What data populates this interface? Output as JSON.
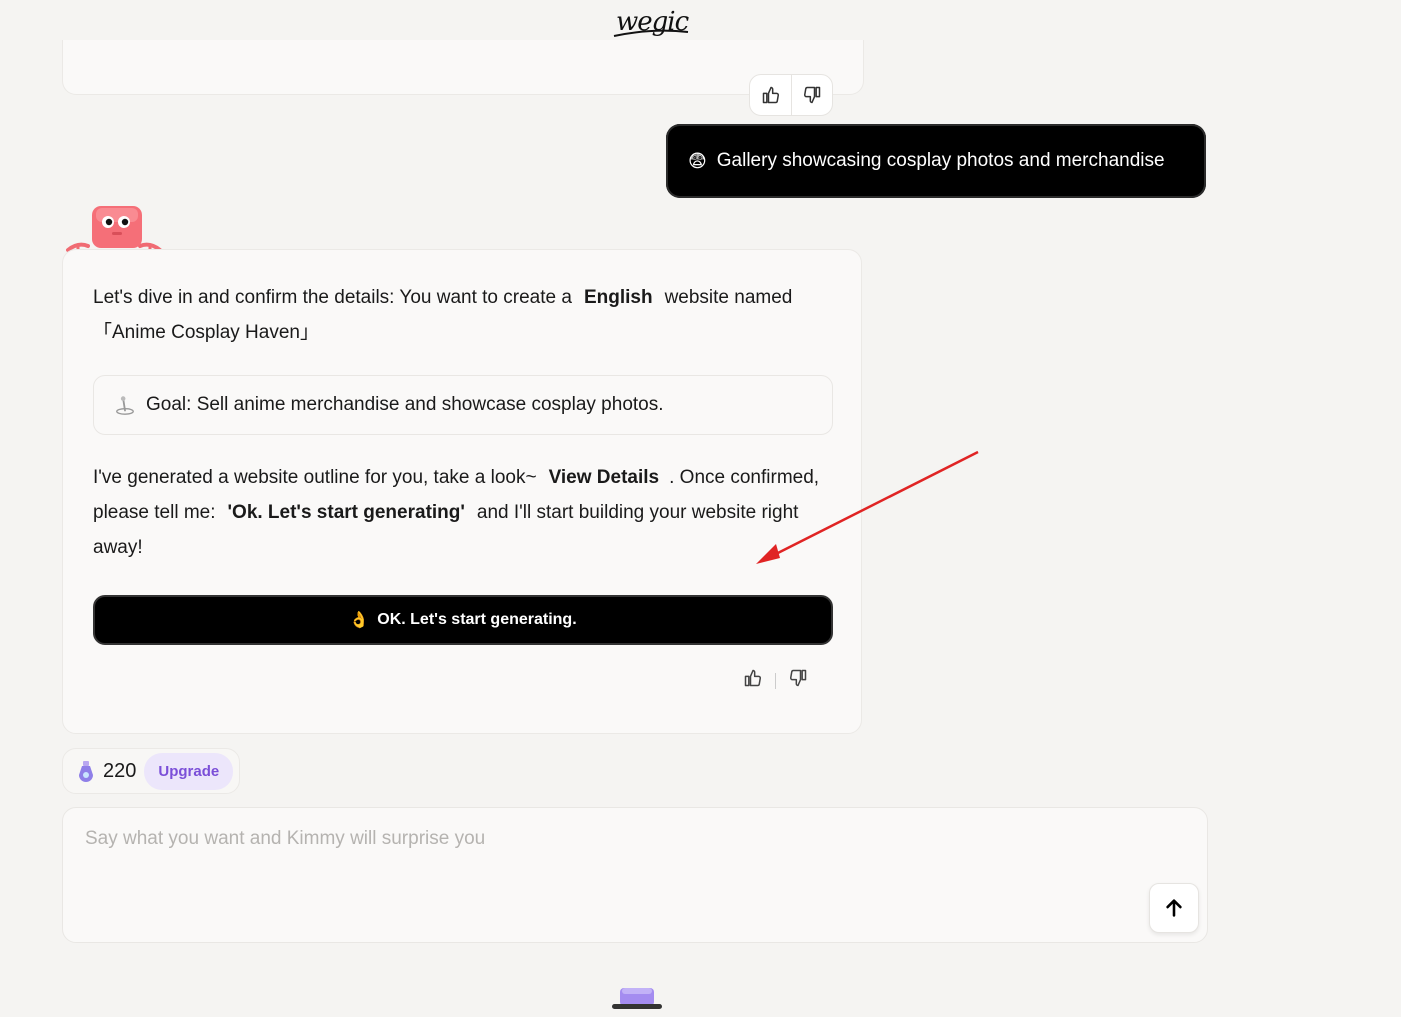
{
  "brand": {
    "logo_text": "wegic"
  },
  "user_message": {
    "emoji": "😨",
    "text": "Gallery showcasing cosplay photos and merchandise"
  },
  "assistant": {
    "intro_prefix": "Let's dive in and confirm the details: You want to create a",
    "language": "English",
    "intro_suffix": "website named",
    "site_name": "「Anime Cosplay Haven」",
    "goal": "Goal: Sell anime merchandise and showcase cosplay photos.",
    "outline_prefix": "I've generated a website outline for you, take a look~",
    "view_details": "View Details",
    "outline_mid": ". Once confirmed, please tell me:",
    "confirm_phrase": "'Ok. Let's start generating'",
    "outline_suffix": "and I'll start building your website right away!",
    "generate_button": {
      "emoji": "👌",
      "label": "OK. Let's start generating."
    }
  },
  "credits": {
    "count": "220",
    "upgrade_label": "Upgrade"
  },
  "composer": {
    "placeholder": "Say what you want and Kimmy will surprise you"
  },
  "colors": {
    "accent": "#7b4fd8",
    "arrow": "#e02424",
    "mascot": "#f06b73"
  }
}
